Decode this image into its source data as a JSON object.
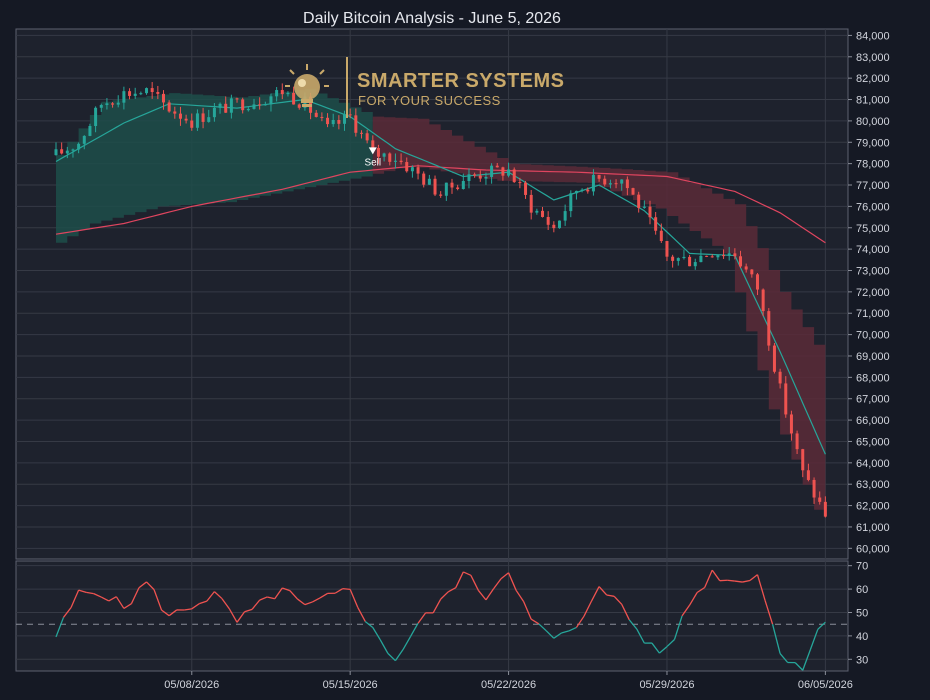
{
  "chart_data": {
    "type": "candlestick",
    "title": "Daily Bitcoin Analysis - June 5, 2026",
    "price_axis": {
      "ylim": [
        59500,
        84300
      ],
      "ticks": [
        60000,
        61000,
        62000,
        63000,
        64000,
        65000,
        66000,
        67000,
        68000,
        69000,
        70000,
        71000,
        72000,
        73000,
        74000,
        75000,
        76000,
        77000,
        78000,
        79000,
        80000,
        81000,
        82000,
        83000,
        84000
      ],
      "tick_labels": [
        "60,000",
        "61,000",
        "62,000",
        "63,000",
        "64,000",
        "65,000",
        "66,000",
        "67,000",
        "68,000",
        "69,000",
        "70,000",
        "71,000",
        "72,000",
        "73,000",
        "74,000",
        "75,000",
        "76,000",
        "77,000",
        "78,000",
        "79,000",
        "80,000",
        "81,000",
        "82,000",
        "83,000",
        "84,000"
      ]
    },
    "date_axis": {
      "range": [
        "2026-05-02",
        "2026-06-06"
      ],
      "ticks": [
        "2026-05-08",
        "2026-05-15",
        "2026-05-22",
        "2026-05-29",
        "2026-06-05"
      ],
      "tick_labels": [
        "05/08/2026",
        "05/15/2026",
        "05/22/2026",
        "05/29/2026",
        "06/05/2026"
      ]
    },
    "close_path": [
      [
        "2026-05-02",
        78400
      ],
      [
        "2026-05-03",
        79000
      ],
      [
        "2026-05-04",
        80800
      ],
      [
        "2026-05-05",
        81300
      ],
      [
        "2026-05-06",
        81400
      ],
      [
        "2026-05-07",
        80600
      ],
      [
        "2026-05-08",
        80000
      ],
      [
        "2026-05-09",
        80500
      ],
      [
        "2026-05-10",
        80800
      ],
      [
        "2026-05-11",
        81000
      ],
      [
        "2026-05-12",
        81400
      ],
      [
        "2026-05-13",
        80800
      ],
      [
        "2026-05-14",
        79600
      ],
      [
        "2026-05-15",
        80200
      ],
      [
        "2026-05-16",
        78500
      ],
      [
        "2026-05-17",
        78300
      ],
      [
        "2026-05-18",
        77500
      ],
      [
        "2026-05-19",
        76600
      ],
      [
        "2026-05-20",
        77300
      ],
      [
        "2026-05-21",
        77600
      ],
      [
        "2026-05-22",
        77700
      ],
      [
        "2026-05-23",
        76000
      ],
      [
        "2026-05-24",
        75000
      ],
      [
        "2026-05-25",
        76800
      ],
      [
        "2026-05-26",
        77300
      ],
      [
        "2026-05-27",
        77300
      ],
      [
        "2026-05-28",
        75700
      ],
      [
        "2026-05-29",
        73600
      ],
      [
        "2026-05-30",
        73500
      ],
      [
        "2026-05-31",
        73900
      ],
      [
        "2026-06-01",
        73800
      ],
      [
        "2026-06-02",
        72200
      ],
      [
        "2026-06-03",
        67400
      ],
      [
        "2026-06-04",
        63500
      ],
      [
        "2026-06-05",
        61600
      ]
    ],
    "series": [
      {
        "name": "",
        "type": "moving_average_slow",
        "color": "#e0455f",
        "points": [
          [
            "2026-05-02",
            74700
          ],
          [
            "2026-05-05",
            75200
          ],
          [
            "2026-05-08",
            76000
          ],
          [
            "2026-05-12",
            76800
          ],
          [
            "2026-05-15",
            77600
          ],
          [
            "2026-05-18",
            77900
          ],
          [
            "2026-05-21",
            77700
          ],
          [
            "2026-05-25",
            77600
          ],
          [
            "2026-05-29",
            77400
          ],
          [
            "2026-06-01",
            76700
          ],
          [
            "2026-06-03",
            75700
          ],
          [
            "2026-06-05",
            74300
          ]
        ]
      },
      {
        "name": "",
        "type": "moving_average_fast",
        "color": "#26a69a",
        "points": [
          [
            "2026-05-02",
            78100
          ],
          [
            "2026-05-05",
            79900
          ],
          [
            "2026-05-07",
            80800
          ],
          [
            "2026-05-10",
            80600
          ],
          [
            "2026-05-13",
            81000
          ],
          [
            "2026-05-15",
            80200
          ],
          [
            "2026-05-17",
            78700
          ],
          [
            "2026-05-20",
            77400
          ],
          [
            "2026-05-22",
            77600
          ],
          [
            "2026-05-24",
            76300
          ],
          [
            "2026-05-26",
            77000
          ],
          [
            "2026-05-28",
            75800
          ],
          [
            "2026-05-30",
            73800
          ],
          [
            "2026-06-01",
            73700
          ],
          [
            "2026-06-03",
            69200
          ],
          [
            "2026-06-05",
            64400
          ]
        ]
      }
    ],
    "channel": {
      "upper": [
        [
          "2026-05-02",
          78400
        ],
        [
          "2026-05-04",
          80900
        ],
        [
          "2026-05-07",
          81300
        ],
        [
          "2026-05-10",
          81100
        ],
        [
          "2026-05-13",
          81500
        ],
        [
          "2026-05-16",
          80200
        ],
        [
          "2026-05-18",
          80100
        ],
        [
          "2026-05-22",
          78000
        ],
        [
          "2026-05-26",
          77800
        ],
        [
          "2026-05-29",
          77600
        ],
        [
          "2026-06-01",
          76100
        ],
        [
          "2026-06-03",
          72000
        ],
        [
          "2026-06-05",
          68700
        ]
      ],
      "lower": [
        [
          "2026-05-02",
          74000
        ],
        [
          "2026-05-04",
          75200
        ],
        [
          "2026-05-07",
          76000
        ],
        [
          "2026-05-10",
          76200
        ],
        [
          "2026-05-13",
          76800
        ],
        [
          "2026-05-16",
          77400
        ],
        [
          "2026-05-18",
          77900
        ],
        [
          "2026-05-22",
          77200
        ],
        [
          "2026-05-26",
          77100
        ],
        [
          "2026-05-29",
          75900
        ],
        [
          "2026-06-01",
          73800
        ],
        [
          "2026-06-03",
          66500
        ],
        [
          "2026-06-05",
          61800
        ]
      ],
      "bull_color": "#1d4e4a",
      "bear_color": "#5a2a38"
    },
    "signal": {
      "date": "2026-05-16",
      "price": 78200,
      "label": "Sell",
      "color": "#ffffff"
    },
    "oscillator": {
      "ylim": [
        25,
        72
      ],
      "ticks": [
        30,
        40,
        50,
        60,
        70
      ],
      "tick_labels": [
        "30",
        "40",
        "50",
        "60",
        "70"
      ],
      "midline": 45,
      "values": [
        [
          "2026-05-02",
          40
        ],
        [
          "2026-05-03",
          58
        ],
        [
          "2026-05-04",
          59
        ],
        [
          "2026-05-05",
          52
        ],
        [
          "2026-05-06",
          63
        ],
        [
          "2026-05-07",
          48
        ],
        [
          "2026-05-08",
          53
        ],
        [
          "2026-05-09",
          58
        ],
        [
          "2026-05-10",
          46
        ],
        [
          "2026-05-11",
          53
        ],
        [
          "2026-05-12",
          60
        ],
        [
          "2026-05-13",
          52
        ],
        [
          "2026-05-14",
          56
        ],
        [
          "2026-05-15",
          60
        ],
        [
          "2026-05-16",
          42
        ],
        [
          "2026-05-17",
          30
        ],
        [
          "2026-05-18",
          45
        ],
        [
          "2026-05-19",
          54
        ],
        [
          "2026-05-20",
          67
        ],
        [
          "2026-05-21",
          57
        ],
        [
          "2026-05-22",
          69
        ],
        [
          "2026-05-23",
          46
        ],
        [
          "2026-05-24",
          39
        ],
        [
          "2026-05-25",
          42
        ],
        [
          "2026-05-26",
          63
        ],
        [
          "2026-05-27",
          52
        ],
        [
          "2026-05-28",
          38
        ],
        [
          "2026-05-29",
          33
        ],
        [
          "2026-05-30",
          54
        ],
        [
          "2026-05-31",
          67
        ],
        [
          "2026-06-01",
          63
        ],
        [
          "2026-06-02",
          67
        ],
        [
          "2026-06-03",
          33
        ],
        [
          "2026-06-04",
          27
        ],
        [
          "2026-06-05",
          48
        ]
      ]
    },
    "colors": {
      "up": "#26a69a",
      "down": "#ef5350",
      "background": "#1e222d",
      "grid": "#363a45"
    }
  },
  "logo": {
    "line1": "SMARTER SYSTEMS",
    "line2": "FOR YOUR SUCCESS",
    "color": "#c9a96a"
  }
}
